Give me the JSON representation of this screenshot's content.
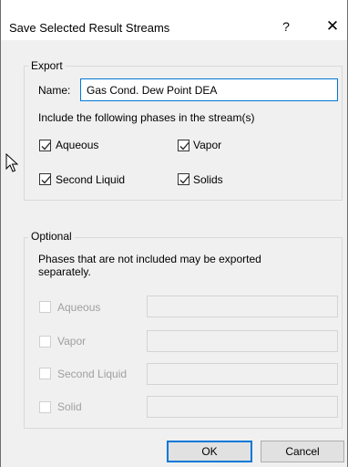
{
  "window": {
    "title": "Save Selected Result Streams",
    "help_glyph": "?",
    "close_glyph": "✕"
  },
  "export": {
    "legend": "Export",
    "name_label": "Name:",
    "name_value": "Gas Cond. Dew Point DEA",
    "include_text": "Include the following phases in the stream(s)",
    "phases": [
      {
        "label": "Aqueous",
        "checked": true
      },
      {
        "label": "Vapor",
        "checked": true
      },
      {
        "label": "Second Liquid",
        "checked": true
      },
      {
        "label": "Solids",
        "checked": true
      }
    ]
  },
  "optional": {
    "legend": "Optional",
    "note": "Phases that are not included may be exported separately.",
    "phases": [
      {
        "label": "Aqueous",
        "checked": false,
        "value": ""
      },
      {
        "label": "Vapor",
        "checked": false,
        "value": ""
      },
      {
        "label": "Second Liquid",
        "checked": false,
        "value": ""
      },
      {
        "label": "Solid",
        "checked": false,
        "value": ""
      }
    ]
  },
  "buttons": {
    "ok": "OK",
    "cancel": "Cancel"
  },
  "colors": {
    "accent": "#0078d7",
    "disabled_text": "#a0a0a0"
  }
}
